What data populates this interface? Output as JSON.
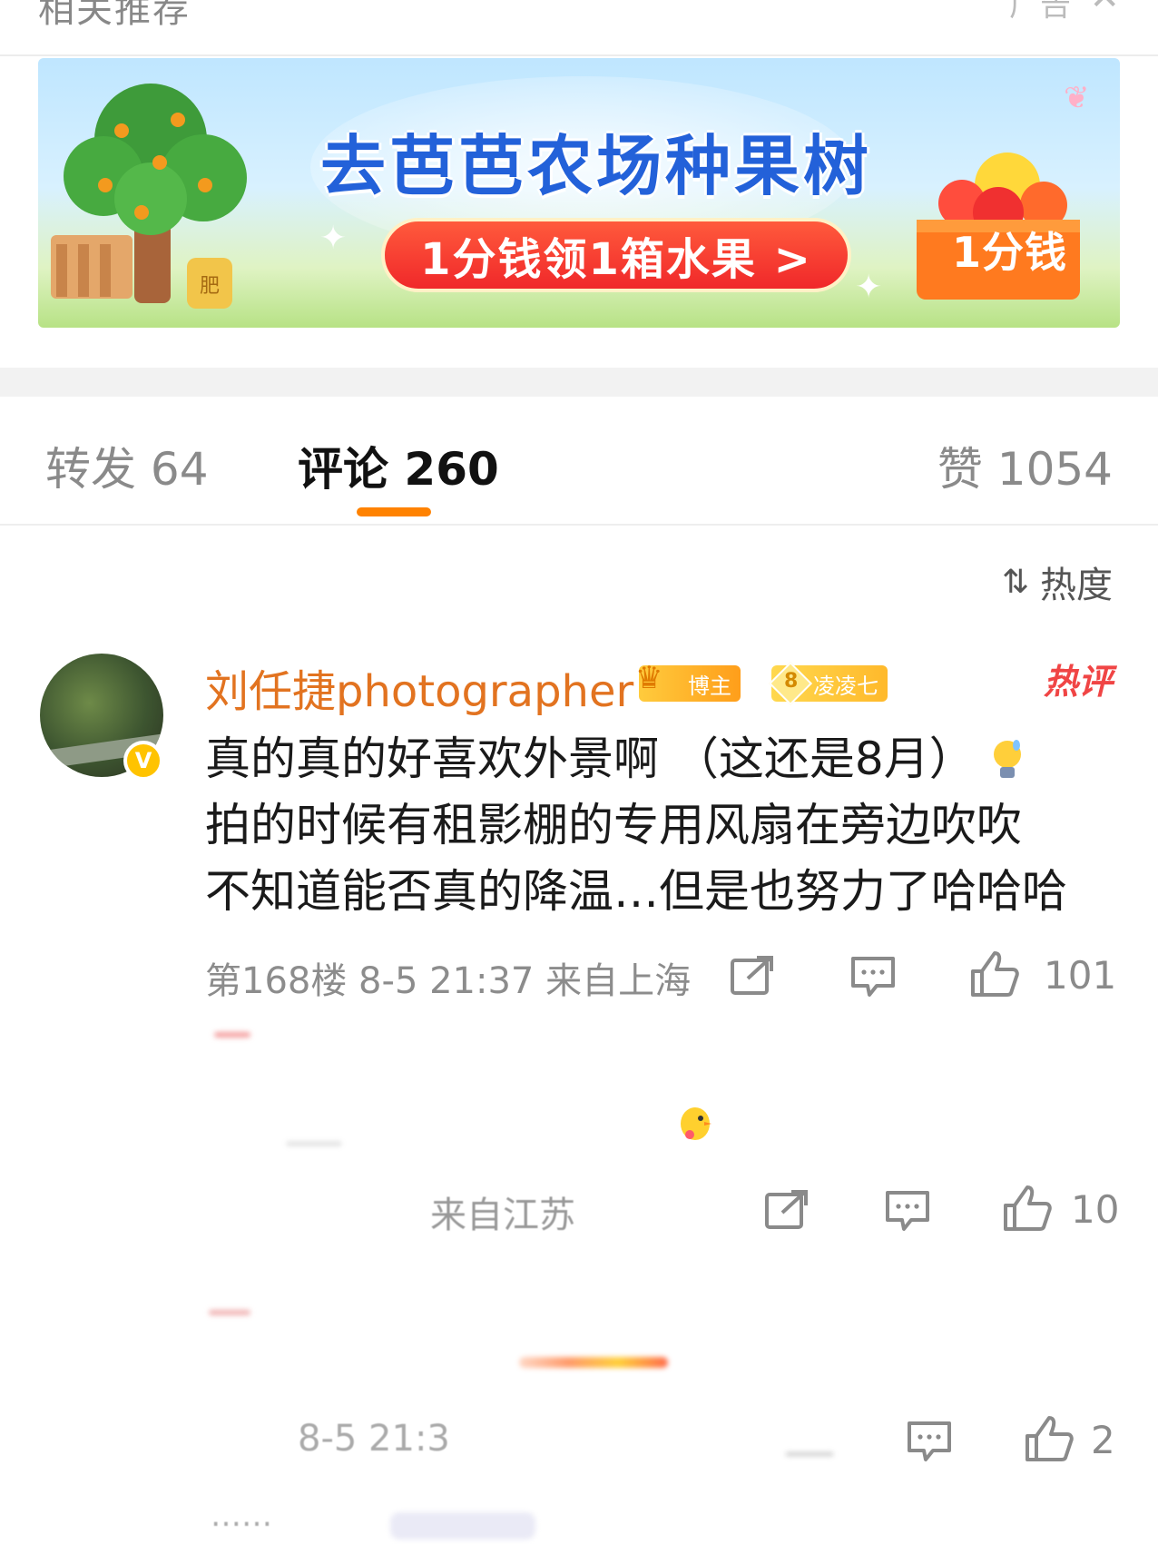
{
  "top_strip": {
    "title": "相关推荐",
    "ad_label": "广告",
    "close_icon": "close-icon"
  },
  "banner": {
    "title": "去芭芭农场种果树",
    "cta": "1分钱领1箱水果 >",
    "box_label": "1分钱",
    "fertilizer_label": "肥"
  },
  "tabs": {
    "repost": "转发 64",
    "comment": "评论 260",
    "like": "赞 1054",
    "active": "comment",
    "accent_color": "#ff8200"
  },
  "sort": {
    "label": "热度",
    "icon": "sort-icon"
  },
  "comments": [
    {
      "username": "刘任捷photographer",
      "badge_blogger": "博主",
      "badge_fan_level": "8",
      "badge_fan_name": "凌凌七",
      "hot_label": "热评",
      "text": "真的真的好喜欢外景啊 （这还是8月）",
      "text_line2": "拍的时候有租影棚的专用风扇在旁边吹吹",
      "text_line3": "不知道能否真的降温…但是也努力了哈哈哈",
      "meta": "第168楼 8-5 21:37 来自上海",
      "likes": "101"
    },
    {
      "meta_partial": "来自江苏",
      "likes": "10"
    },
    {
      "meta_partial": "8-5 21:3",
      "likes": "2"
    }
  ],
  "footer_partial": "……"
}
